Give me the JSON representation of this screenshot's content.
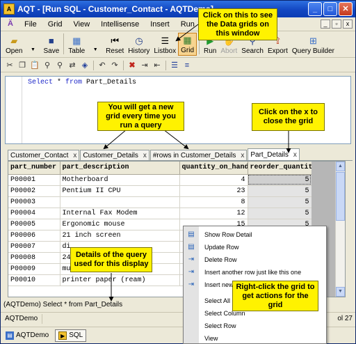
{
  "window": {
    "title": "AQT - [Run SQL - Customer_Contact - AQTDemo]",
    "app_icon": "aqt-app-icon"
  },
  "title_buttons": [
    {
      "name": "minimize-button",
      "glyph": "_"
    },
    {
      "name": "maximize-button",
      "glyph": "□"
    },
    {
      "name": "close-button",
      "glyph": "✕"
    }
  ],
  "menubar": {
    "items": [
      "File",
      "Grid",
      "View",
      "Intellisense",
      "Insert",
      "Run"
    ],
    "mdi_buttons": [
      "_",
      "▫",
      "x"
    ]
  },
  "toolbar": {
    "open": "Open",
    "save": "Save",
    "table": "Table",
    "reset": "Reset",
    "history": "History",
    "listbox": "Listbox",
    "grid": "Grid",
    "run": "Run",
    "abort": "Abort",
    "search": "Search",
    "export": "Export",
    "query_builder": "Query Builder"
  },
  "editor": {
    "kw1": "Select",
    "star": " * ",
    "kw2": "from",
    "rest": " Part_Details"
  },
  "tabs": [
    {
      "label": "Customer_Contact",
      "close": "x",
      "active": false
    },
    {
      "label": "Customer_Details",
      "close": "x",
      "active": false
    },
    {
      "label": "#rows in Customer_Details",
      "close": "x",
      "active": false
    },
    {
      "label": "Part_Details",
      "close": "x",
      "active": true
    }
  ],
  "grid": {
    "columns": [
      "part_number",
      "part_description",
      "quantity_on_hand",
      "reorder_quantity"
    ],
    "rows": [
      [
        "P00001",
        "Motherboard",
        "4",
        "5"
      ],
      [
        "P00002",
        "Pentium II CPU",
        "23",
        "5"
      ],
      [
        "P00003",
        "",
        "8",
        "5"
      ],
      [
        "P00004",
        "Internal Fax Modem",
        "12",
        "5"
      ],
      [
        "P00005",
        "Ergonomic mouse",
        "15",
        "5"
      ],
      [
        "P00006",
        "21 inch screen",
        "",
        ""
      ],
      [
        "P00007",
        "di",
        "",
        ""
      ],
      [
        "P00008",
        "24",
        "",
        ""
      ],
      [
        "P00009",
        "mu",
        "",
        ""
      ],
      [
        "P00010",
        "printer paper (ream)",
        "",
        ""
      ]
    ]
  },
  "query_status": "(AQTDemo) Select * from Part_Details",
  "statusbar": {
    "connection": "AQTDemo",
    "position": "ol 27"
  },
  "taskbar": [
    {
      "label": "AQTDemo",
      "active": false
    },
    {
      "label": "SQL",
      "active": true
    }
  ],
  "context_menu": [
    {
      "label": "Show Row Detail",
      "icon": "row-detail-icon"
    },
    {
      "label": "Update Row",
      "icon": "update-row-icon"
    },
    {
      "label": "Delete Row",
      "icon": "delete-row-icon"
    },
    {
      "label": "Insert another row just like this one",
      "icon": "insert-copy-row-icon"
    },
    {
      "label": "Insert new",
      "icon": "insert-new-row-icon"
    },
    {
      "label": "Select All",
      "icon": ""
    },
    {
      "label": "Select Column",
      "icon": ""
    },
    {
      "label": "Select Row",
      "icon": ""
    },
    {
      "label": "View",
      "icon": ""
    }
  ],
  "callouts": {
    "grid_button": "Click on this to see the Data grids on this window",
    "new_grid": "You will get a new grid every time you run a query",
    "close_grid": "Click on the x to close the grid",
    "query_details": "Details of the query used for this display",
    "right_click": "Right-click the grid to get actions for the grid"
  },
  "colors": {
    "callout": "#FFF200",
    "title_bar": "#1347C2",
    "active_tool": "#F7D490"
  }
}
